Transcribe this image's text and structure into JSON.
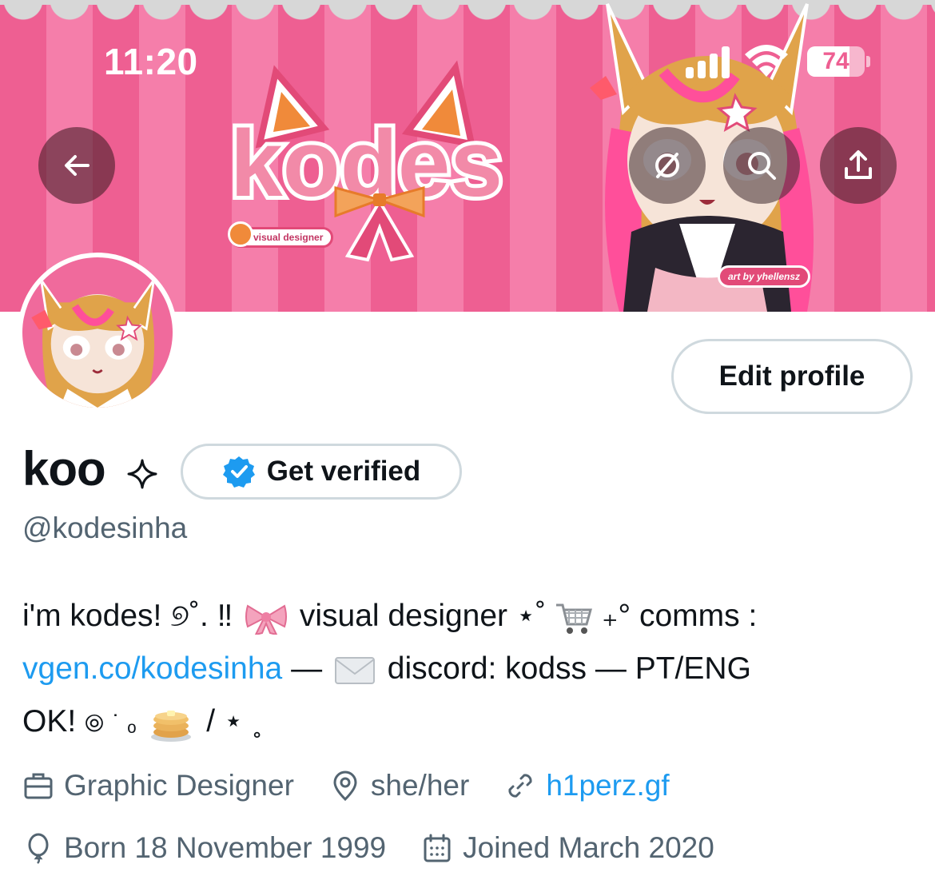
{
  "status_bar": {
    "time": "11:20",
    "battery_level": 74,
    "battery_text": "74"
  },
  "banner": {
    "logo_text": "kodes",
    "logo_tagline": "visual designer",
    "art_credit": "art by yhellensz"
  },
  "profile": {
    "display_name": "koo",
    "handle": "@kodesinha",
    "edit_profile_label": "Edit profile",
    "get_verified_label": "Get verified"
  },
  "bio": {
    "l1_a": "i'm kodes! ୭˚. ‼",
    "l1_b": "visual designer ⋆˚",
    "l1_c": "₊° comms :",
    "l2_link": "vgen.co/kodesinha",
    "l2_a": " — ",
    "l2_b": " discord: kodss — PT/ENG",
    "l3_a": "OK! ",
    "l3_spiral": "⦾",
    "l3_b": "˙ ₒ",
    "l3_c": "/ ⋆ ˳"
  },
  "meta": {
    "profession": "Graphic Designer",
    "location": "she/her",
    "website": "h1perz.gf",
    "birthday": "Born 18 November 1999",
    "joined": "Joined March 2020"
  },
  "icons": {
    "back": "arrow-left-icon",
    "hide": "eye-slash-icon",
    "search": "search-icon",
    "share": "share-icon",
    "verified": "verified-badge-icon",
    "sparkle": "sparkle-icon",
    "briefcase": "briefcase-icon",
    "location": "location-pin-icon",
    "link": "link-icon",
    "balloon": "balloon-icon",
    "calendar": "calendar-icon"
  },
  "colors": {
    "accent": "#1d9bf0",
    "secondary_text": "#536471",
    "border": "#cfd9de",
    "banner_pink": "#ee5f92"
  }
}
